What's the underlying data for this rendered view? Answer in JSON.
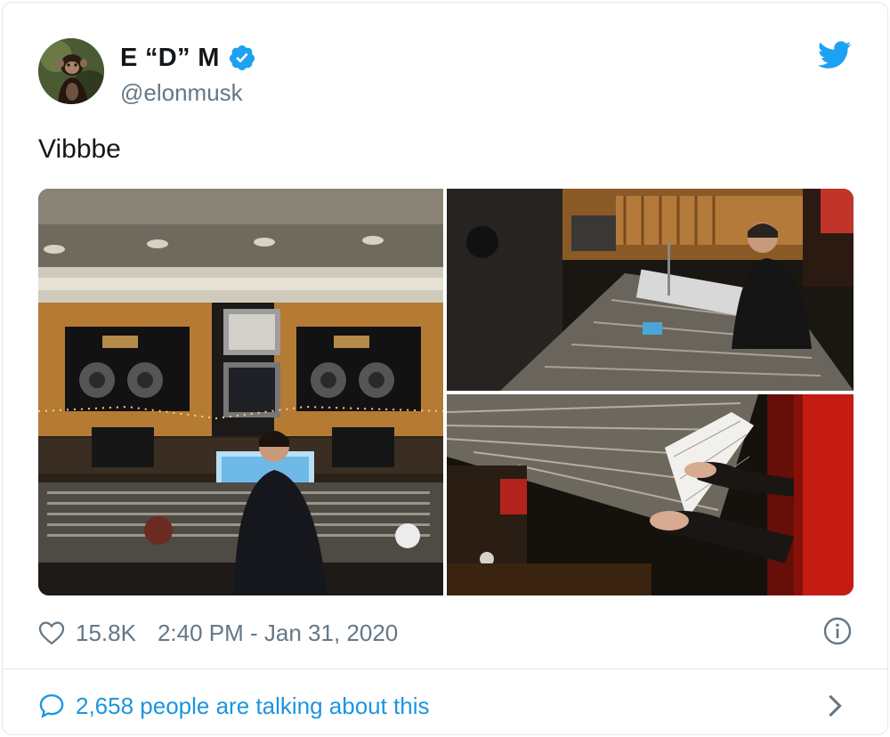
{
  "author": {
    "display_name": "E “D” M",
    "handle": "@elonmusk",
    "verified": true
  },
  "tweet": {
    "text": "Vibbbe",
    "likes": "15.8K",
    "timestamp": "2:40 PM - Jan 31, 2020"
  },
  "footer": {
    "conversation_label": "2,658 people are talking about this"
  },
  "icons": {
    "brand": "twitter-bird-icon",
    "verified": "verified-badge-icon",
    "like": "heart-icon",
    "info": "info-icon",
    "reply": "speech-bubble-icon",
    "more": "chevron-right-icon"
  },
  "colors": {
    "brand_blue": "#1da1f2",
    "link_blue": "#1b95e0",
    "secondary_text": "#657786",
    "primary_text": "#14171a",
    "border": "#e1e8ed"
  }
}
